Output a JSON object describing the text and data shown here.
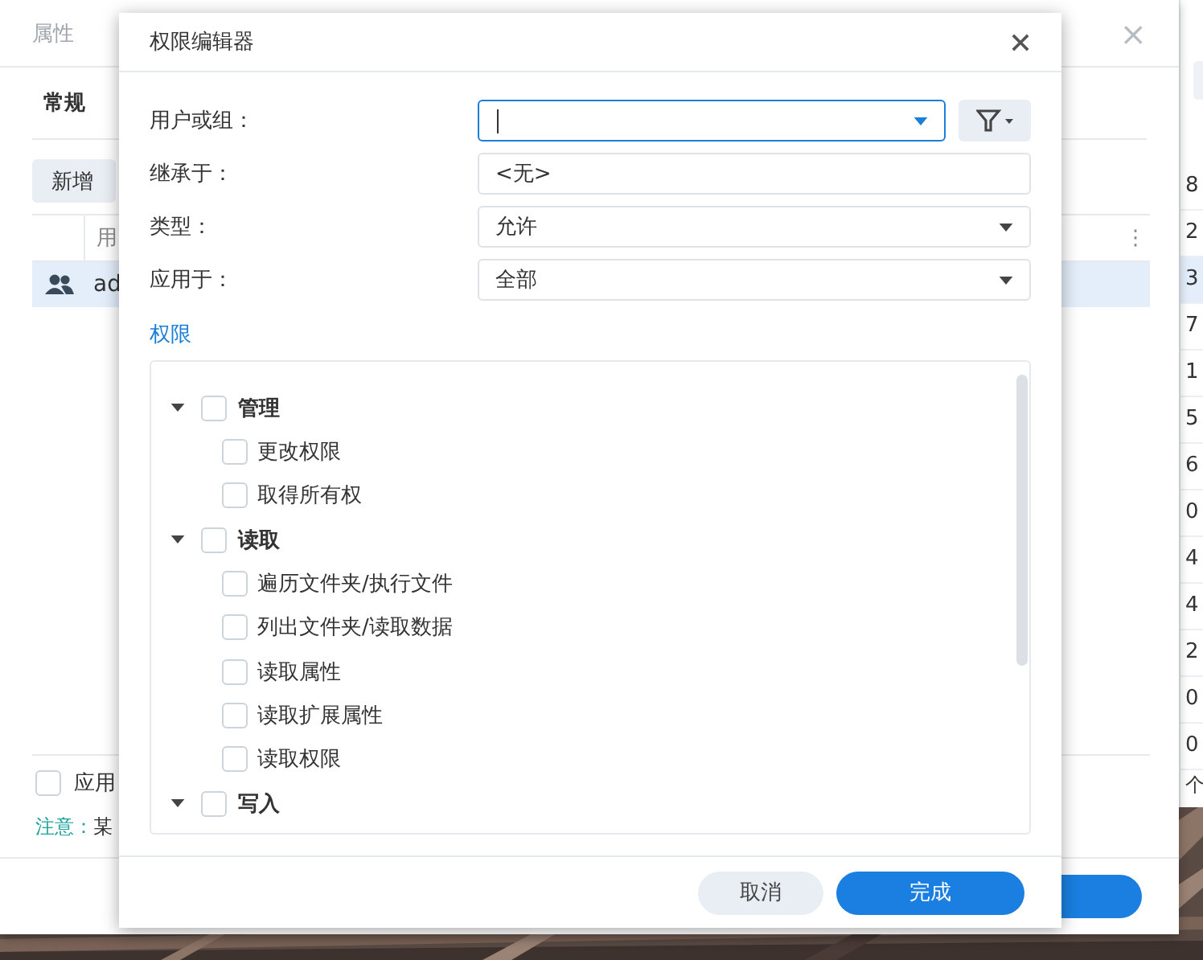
{
  "back_window": {
    "title": "属性",
    "close": "×",
    "tab": "常规",
    "add_button": "新增",
    "column_header": "用",
    "column_menu": "⋮",
    "rows": [
      {
        "text": "ad",
        "selected": true
      }
    ],
    "apply_checkbox": {
      "label": "应用",
      "checked": false
    },
    "note": {
      "label": "注意：",
      "text": "某"
    }
  },
  "side_window": {
    "cells": [
      {
        "text": "8",
        "selected": false
      },
      {
        "text": "2",
        "selected": false
      },
      {
        "text": "3",
        "selected": true
      },
      {
        "text": "7",
        "selected": false
      },
      {
        "text": "1",
        "selected": false
      },
      {
        "text": "5",
        "selected": false
      },
      {
        "text": "6",
        "selected": false
      },
      {
        "text": "0",
        "selected": false
      },
      {
        "text": "4",
        "selected": false
      },
      {
        "text": "4",
        "selected": false
      },
      {
        "text": "2",
        "selected": false
      },
      {
        "text": "0",
        "selected": false
      },
      {
        "text": "0",
        "selected": false
      }
    ],
    "footer": "个"
  },
  "dialog": {
    "title": "权限编辑器",
    "fields": [
      {
        "kind": "combo",
        "label": "用户或组：",
        "focused": true
      },
      {
        "kind": "text",
        "label": "继承于：",
        "value": "<无>",
        "focused": false
      },
      {
        "kind": "select",
        "label": "类型：",
        "value": "允许",
        "focused": false
      },
      {
        "kind": "select",
        "label": "应用于：",
        "value": "全部",
        "focused": false
      }
    ],
    "section": "权限",
    "tree": [
      {
        "label": "管理",
        "expanded": true,
        "checked": false,
        "children": [
          {
            "label": "更改权限",
            "checked": false
          },
          {
            "label": "取得所有权",
            "checked": false
          }
        ]
      },
      {
        "label": "读取",
        "expanded": true,
        "checked": false,
        "children": [
          {
            "label": "遍历文件夹/执行文件",
            "checked": false
          },
          {
            "label": "列出文件夹/读取数据",
            "checked": false
          },
          {
            "label": "读取属性",
            "checked": false
          },
          {
            "label": "读取扩展属性",
            "checked": false
          },
          {
            "label": "读取权限",
            "checked": false
          }
        ]
      },
      {
        "label": "写入",
        "expanded": true,
        "checked": false
      }
    ],
    "buttons": [
      {
        "label": "取消",
        "kind": "secondary"
      },
      {
        "label": "完成",
        "kind": "primary"
      }
    ]
  }
}
